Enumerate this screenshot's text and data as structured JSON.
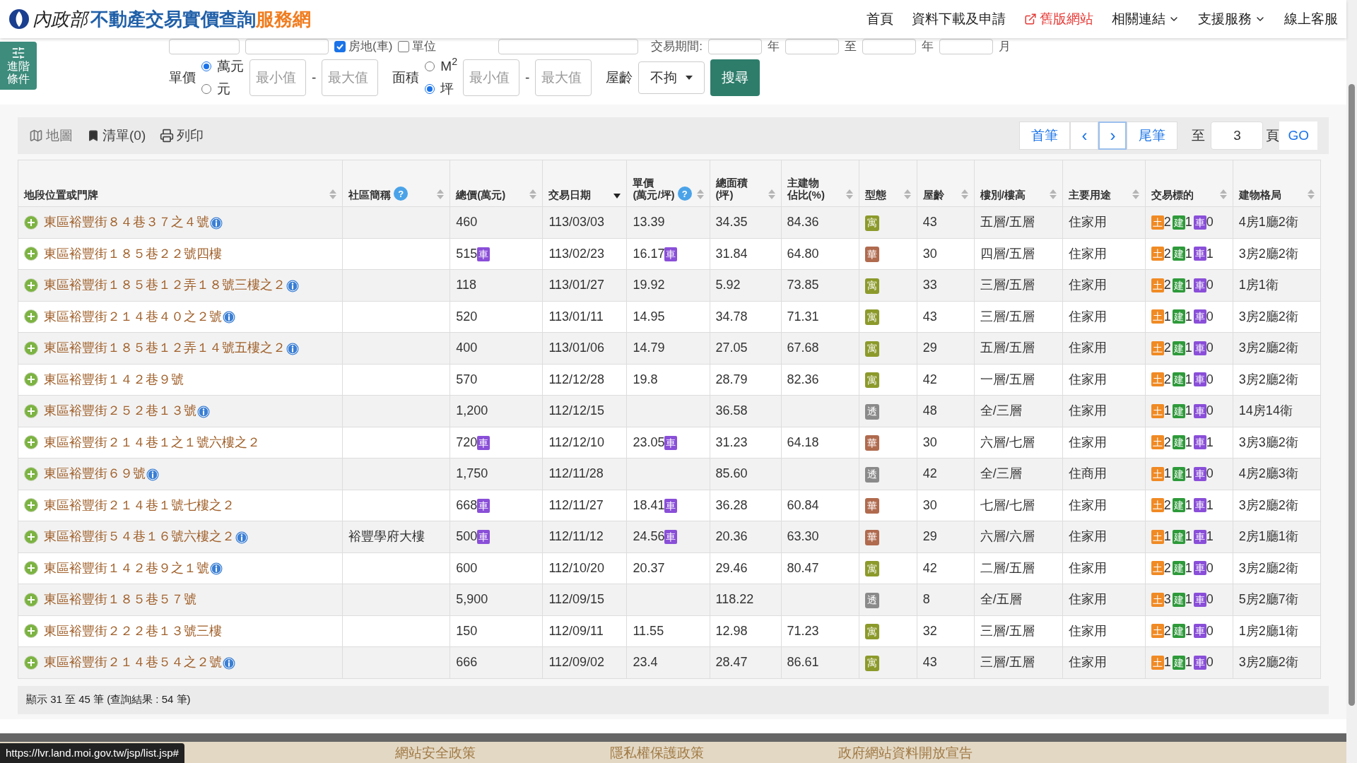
{
  "header": {
    "logo_ministry": "內政部",
    "logo_title": "不動產交易實價查詢",
    "logo_suffix": "服務網",
    "nav": [
      {
        "label": "首頁",
        "kind": "link"
      },
      {
        "label": "資料下載及申請",
        "kind": "link"
      },
      {
        "label": "舊版網站",
        "kind": "external"
      },
      {
        "label": "相關連結",
        "kind": "dropdown"
      },
      {
        "label": "支援服務",
        "kind": "dropdown"
      },
      {
        "label": "線上客服",
        "kind": "link"
      }
    ]
  },
  "advanced_button": "進階條件",
  "filters_top": {
    "checkboxes": [
      {
        "label": "房地(車)",
        "checked": true
      },
      {
        "label": "單位",
        "checked": false
      }
    ],
    "period_label": "交易期間:",
    "period_units": [
      "年",
      "至",
      "年",
      "月"
    ]
  },
  "filters": {
    "price_label": "單價",
    "price_units": [
      {
        "label": "萬元",
        "selected": true
      },
      {
        "label": "元",
        "selected": false
      }
    ],
    "min_placeholder": "最小值",
    "max_placeholder": "最大值",
    "dash": "-",
    "area_label": "面積",
    "area_units": [
      {
        "label": "M$^{2}$",
        "selected": false
      },
      {
        "label": "坪",
        "selected": true
      }
    ],
    "area_min_placeholder": "最小值",
    "area_max_placeholder": "最大值",
    "area_dash": "-",
    "age_label": "屋齡",
    "age_value": "不拘",
    "search": "搜尋"
  },
  "toolbar": {
    "map": "地圖",
    "list": "清單(0)",
    "print": "列印"
  },
  "pager": {
    "first": "首筆",
    "prev": "‹",
    "next": "›",
    "last": "尾筆",
    "to": "至",
    "page": "3",
    "page_unit": "頁",
    "go": "GO"
  },
  "table": {
    "columns": [
      {
        "lines": [
          "地段位置或門牌"
        ],
        "selected": false
      },
      {
        "lines": [
          "社區簡稱"
        ],
        "selected": false,
        "help": "?"
      },
      {
        "lines": [
          "總價(萬元)"
        ],
        "selected": false
      },
      {
        "lines": [
          "交易日期"
        ],
        "selected": true
      },
      {
        "lines": [
          "單價",
          "(萬元/坪)"
        ],
        "selected": false,
        "help": "?"
      },
      {
        "lines": [
          "總面積",
          "(坪)"
        ],
        "selected": false
      },
      {
        "lines": [
          "主建物",
          "佔比(%)"
        ],
        "selected": false
      },
      {
        "lines": [
          "型態"
        ],
        "selected": false
      },
      {
        "lines": [
          "屋齡"
        ],
        "selected": false
      },
      {
        "lines": [
          "樓別/樓高"
        ],
        "selected": false
      },
      {
        "lines": [
          "主要用途"
        ],
        "selected": false
      },
      {
        "lines": [
          "交易標的"
        ],
        "selected": false
      },
      {
        "lines": [
          "建物格局"
        ],
        "selected": false
      }
    ],
    "rows": [
      {
        "address": "東區裕豐街８４巷３７之４號",
        "info": true,
        "total": "460",
        "date": "113/03/03",
        "unit": "13.39",
        "area": "34.35",
        "ratio": "84.36",
        "type": {
          "label": "寓",
          "color": "#8c9a2b"
        },
        "age": "43",
        "floor": "五層/五層",
        "use": "住家用",
        "targets": [
          {
            "kind": "land",
            "badge": "土",
            "count": "2"
          },
          {
            "kind": "building",
            "badge": "建",
            "count": "1"
          },
          {
            "kind": "parking",
            "badge": "車",
            "count": "0"
          }
        ],
        "layout": "4房1廳2衛"
      },
      {
        "address": "東區裕豐街１８５巷２２號四樓",
        "info": false,
        "total": "515",
        "total_badge": "車",
        "date": "113/02/23",
        "unit": "16.17",
        "unit_badge": "車",
        "area": "31.84",
        "ratio": "64.80",
        "type": {
          "label": "華",
          "color": "#b06a4e"
        },
        "age": "30",
        "floor": "四層/五層",
        "use": "住家用",
        "targets": [
          {
            "kind": "land",
            "badge": "土",
            "count": "2"
          },
          {
            "kind": "building",
            "badge": "建",
            "count": "1"
          },
          {
            "kind": "parking",
            "badge": "車",
            "count": "1"
          }
        ],
        "layout": "3房2廳2衛"
      },
      {
        "address": "東區裕豐街１８５巷１２弄１８號三樓之２",
        "info": true,
        "total": "118",
        "date": "113/01/27",
        "unit": "19.92",
        "area": "5.92",
        "ratio": "73.85",
        "type": {
          "label": "寓",
          "color": "#8c9a2b"
        },
        "age": "33",
        "floor": "三層/五層",
        "use": "住家用",
        "targets": [
          {
            "kind": "land",
            "badge": "土",
            "count": "2"
          },
          {
            "kind": "building",
            "badge": "建",
            "count": "1"
          },
          {
            "kind": "parking",
            "badge": "車",
            "count": "0"
          }
        ],
        "layout": "1房1衛"
      },
      {
        "address": "東區裕豐街２１４巷４０之２號",
        "info": true,
        "total": "520",
        "date": "113/01/11",
        "unit": "14.95",
        "area": "34.78",
        "ratio": "71.31",
        "type": {
          "label": "寓",
          "color": "#8c9a2b"
        },
        "age": "43",
        "floor": "三層/五層",
        "use": "住家用",
        "targets": [
          {
            "kind": "land",
            "badge": "土",
            "count": "1"
          },
          {
            "kind": "building",
            "badge": "建",
            "count": "1"
          },
          {
            "kind": "parking",
            "badge": "車",
            "count": "0"
          }
        ],
        "layout": "3房2廳2衛"
      },
      {
        "address": "東區裕豐街１８５巷１２弄１４號五樓之２",
        "info": true,
        "total": "400",
        "date": "113/01/06",
        "unit": "14.79",
        "area": "27.05",
        "ratio": "67.68",
        "type": {
          "label": "寓",
          "color": "#8c9a2b"
        },
        "age": "29",
        "floor": "五層/五層",
        "use": "住家用",
        "targets": [
          {
            "kind": "land",
            "badge": "土",
            "count": "2"
          },
          {
            "kind": "building",
            "badge": "建",
            "count": "1"
          },
          {
            "kind": "parking",
            "badge": "車",
            "count": "0"
          }
        ],
        "layout": "3房2廳2衛"
      },
      {
        "address": "東區裕豐街１４２巷９號",
        "info": false,
        "total": "570",
        "date": "112/12/28",
        "unit": "19.8",
        "area": "28.79",
        "ratio": "82.36",
        "type": {
          "label": "寓",
          "color": "#8c9a2b"
        },
        "age": "42",
        "floor": "一層/五層",
        "use": "住家用",
        "targets": [
          {
            "kind": "land",
            "badge": "土",
            "count": "2"
          },
          {
            "kind": "building",
            "badge": "建",
            "count": "1"
          },
          {
            "kind": "parking",
            "badge": "車",
            "count": "0"
          }
        ],
        "layout": "3房2廳2衛"
      },
      {
        "address": "東區裕豐街２５２巷１３號",
        "info": true,
        "total": "1,200",
        "date": "112/12/15",
        "area": "36.58",
        "type": {
          "label": "透",
          "color": "#8a8a8a"
        },
        "age": "48",
        "floor": "全/三層",
        "use": "住家用",
        "targets": [
          {
            "kind": "land",
            "badge": "土",
            "count": "1"
          },
          {
            "kind": "building",
            "badge": "建",
            "count": "1"
          },
          {
            "kind": "parking",
            "badge": "車",
            "count": "0"
          }
        ],
        "layout": "14房14衛"
      },
      {
        "address": "東區裕豐街２１４巷１之１號六樓之２",
        "info": false,
        "total": "720",
        "total_badge": "車",
        "date": "112/12/10",
        "unit": "23.05",
        "unit_badge": "車",
        "area": "31.23",
        "ratio": "64.18",
        "type": {
          "label": "華",
          "color": "#b06a4e"
        },
        "age": "30",
        "floor": "六層/七層",
        "use": "住家用",
        "targets": [
          {
            "kind": "land",
            "badge": "土",
            "count": "2"
          },
          {
            "kind": "building",
            "badge": "建",
            "count": "1"
          },
          {
            "kind": "parking",
            "badge": "車",
            "count": "1"
          }
        ],
        "layout": "3房3廳2衛"
      },
      {
        "address": "東區裕豐街６９號",
        "info": true,
        "total": "1,750",
        "date": "112/11/28",
        "area": "85.60",
        "type": {
          "label": "透",
          "color": "#8a8a8a"
        },
        "age": "42",
        "floor": "全/三層",
        "use": "住商用",
        "targets": [
          {
            "kind": "land",
            "badge": "土",
            "count": "1"
          },
          {
            "kind": "building",
            "badge": "建",
            "count": "1"
          },
          {
            "kind": "parking",
            "badge": "車",
            "count": "0"
          }
        ],
        "layout": "4房2廳3衛"
      },
      {
        "address": "東區裕豐街２１４巷１號七樓之２",
        "info": false,
        "total": "668",
        "total_badge": "車",
        "date": "112/11/27",
        "unit": "18.41",
        "unit_badge": "車",
        "area": "36.28",
        "ratio": "60.84",
        "type": {
          "label": "華",
          "color": "#b06a4e"
        },
        "age": "30",
        "floor": "七層/七層",
        "use": "住家用",
        "targets": [
          {
            "kind": "land",
            "badge": "土",
            "count": "2"
          },
          {
            "kind": "building",
            "badge": "建",
            "count": "1"
          },
          {
            "kind": "parking",
            "badge": "車",
            "count": "1"
          }
        ],
        "layout": "3房2廳2衛"
      },
      {
        "address": "東區裕豐街５４巷１６號六樓之２",
        "info": true,
        "community": "裕豐學府大樓",
        "total": "500",
        "total_badge": "車",
        "date": "112/11/12",
        "unit": "24.56",
        "unit_badge": "車",
        "area": "20.36",
        "ratio": "63.30",
        "type": {
          "label": "華",
          "color": "#b06a4e"
        },
        "age": "29",
        "floor": "六層/六層",
        "use": "住家用",
        "targets": [
          {
            "kind": "land",
            "badge": "土",
            "count": "1"
          },
          {
            "kind": "building",
            "badge": "建",
            "count": "1"
          },
          {
            "kind": "parking",
            "badge": "車",
            "count": "1"
          }
        ],
        "layout": "2房1廳1衛"
      },
      {
        "address": "東區裕豐街１４２巷９之１號",
        "info": true,
        "total": "600",
        "date": "112/10/20",
        "unit": "20.37",
        "area": "29.46",
        "ratio": "80.47",
        "type": {
          "label": "寓",
          "color": "#8c9a2b"
        },
        "age": "42",
        "floor": "二層/五層",
        "use": "住家用",
        "targets": [
          {
            "kind": "land",
            "badge": "土",
            "count": "2"
          },
          {
            "kind": "building",
            "badge": "建",
            "count": "1"
          },
          {
            "kind": "parking",
            "badge": "車",
            "count": "0"
          }
        ],
        "layout": "3房2廳2衛"
      },
      {
        "address": "東區裕豐街１８５巷５７號",
        "info": false,
        "total": "5,900",
        "date": "112/09/15",
        "area": "118.22",
        "type": {
          "label": "透",
          "color": "#8a8a8a"
        },
        "age": "8",
        "floor": "全/五層",
        "use": "住家用",
        "targets": [
          {
            "kind": "land",
            "badge": "土",
            "count": "3"
          },
          {
            "kind": "building",
            "badge": "建",
            "count": "1"
          },
          {
            "kind": "parking",
            "badge": "車",
            "count": "0"
          }
        ],
        "layout": "5房2廳7衛"
      },
      {
        "address": "東區裕豐街２２２巷１３號三樓",
        "info": false,
        "total": "150",
        "date": "112/09/11",
        "unit": "11.55",
        "area": "12.98",
        "ratio": "71.23",
        "type": {
          "label": "寓",
          "color": "#8c9a2b"
        },
        "age": "32",
        "floor": "三層/五層",
        "use": "住家用",
        "targets": [
          {
            "kind": "land",
            "badge": "土",
            "count": "2"
          },
          {
            "kind": "building",
            "badge": "建",
            "count": "1"
          },
          {
            "kind": "parking",
            "badge": "車",
            "count": "0"
          }
        ],
        "layout": "1房2廳1衛"
      },
      {
        "address": "東區裕豐街２１４巷５４之２號",
        "info": true,
        "total": "666",
        "date": "112/09/02",
        "unit": "23.4",
        "area": "28.47",
        "ratio": "86.61",
        "type": {
          "label": "寓",
          "color": "#8c9a2b"
        },
        "age": "43",
        "floor": "三層/五層",
        "use": "住家用",
        "targets": [
          {
            "kind": "land",
            "badge": "土",
            "count": "1"
          },
          {
            "kind": "building",
            "badge": "建",
            "count": "1"
          },
          {
            "kind": "parking",
            "badge": "車",
            "count": "0"
          }
        ],
        "layout": "3房2廳2衛"
      }
    ]
  },
  "summary": "顯示 31 至 45 筆 (查詢結果 : 54 筆)",
  "footer": {
    "links": [
      "網站安全政策",
      "隱私權保護政策",
      "政府網站資料開放宣告"
    ],
    "status_url": "https://lvr.land.moi.gov.tw/jsp/list.jsp#"
  }
}
